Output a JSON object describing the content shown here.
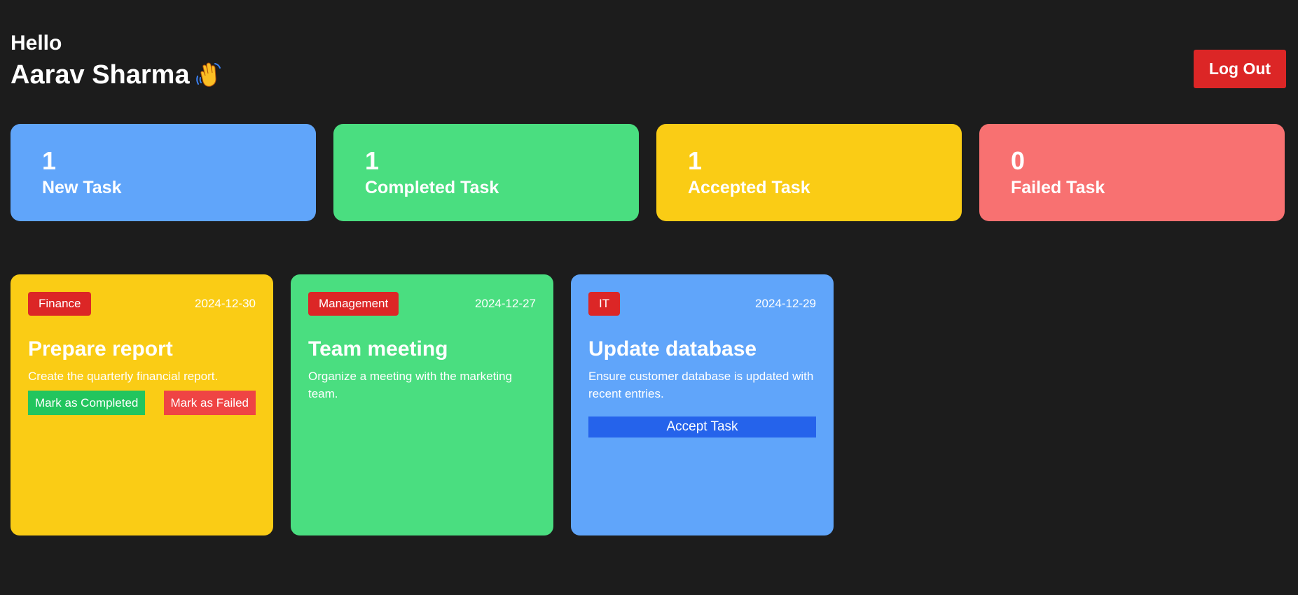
{
  "header": {
    "greeting": "Hello",
    "user_name": "Aarav Sharma",
    "wave_icon": "waving-hand-icon",
    "logout_label": "Log Out",
    "logout_color": "#dc2626"
  },
  "stats": [
    {
      "count": "1",
      "label": "New Task",
      "color": "#60a5fa"
    },
    {
      "count": "1",
      "label": "Completed Task",
      "color": "#4ade80"
    },
    {
      "count": "1",
      "label": "Accepted Task",
      "color": "#facc15"
    },
    {
      "count": "0",
      "label": "Failed Task",
      "color": "#f87171"
    }
  ],
  "tasks": [
    {
      "category": "Finance",
      "date": "2024-12-30",
      "title": "Prepare report",
      "description": "Create the quarterly financial report.",
      "color": "#facc15",
      "actions": {
        "complete": "Mark as Completed",
        "failed": "Mark as Failed"
      }
    },
    {
      "category": "Management",
      "date": "2024-12-27",
      "title": "Team meeting",
      "description": "Organize a meeting with the marketing team.",
      "color": "#4ade80"
    },
    {
      "category": "IT",
      "date": "2024-12-29",
      "title": "Update database",
      "description": "Ensure customer database is updated with recent entries.",
      "color": "#60a5fa",
      "accept_label": "Accept Task"
    }
  ]
}
